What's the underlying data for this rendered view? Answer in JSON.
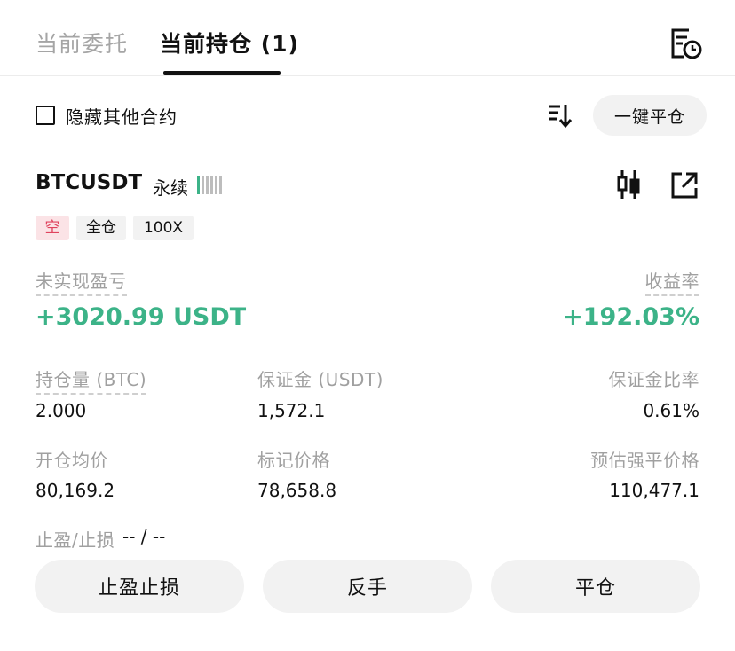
{
  "tabs": {
    "open_orders": "当前委托",
    "positions": "当前持仓 (1)"
  },
  "toolbar": {
    "hide_other": "隐藏其他合约",
    "close_all": "一键平仓"
  },
  "position": {
    "symbol": "BTCUSDT",
    "type": "永续",
    "tags": {
      "side": "空",
      "margin_mode": "全仓",
      "leverage": "100X"
    },
    "unrealized_pnl_label": "未实现盈亏",
    "unrealized_pnl": "+3020.99 USDT",
    "roe_label": "收益率",
    "roe": "+192.03%",
    "size_label": "持仓量 (BTC)",
    "size": "2.000",
    "margin_label": "保证金 (USDT)",
    "margin": "1,572.1",
    "margin_ratio_label": "保证金比率",
    "margin_ratio": "0.61%",
    "entry_price_label": "开仓均价",
    "entry_price": "80,169.2",
    "mark_price_label": "标记价格",
    "mark_price": "78,658.8",
    "liq_price_label": "预估强平价格",
    "liq_price": "110,477.1",
    "tpsl_label": "止盈/止损",
    "tpsl_value": "-- / --"
  },
  "actions": {
    "tpsl": "止盈止损",
    "reverse": "反手",
    "close": "平仓"
  },
  "colors": {
    "profit": "#3cb388",
    "short_tag_bg": "#fbe3e6",
    "short_tag_text": "#e0435e"
  },
  "icons": {
    "history": "order-history-icon",
    "sort": "sort-icon",
    "chart": "candlestick-chart-icon",
    "share": "share-icon",
    "leverage": "leverage-bars-icon"
  }
}
